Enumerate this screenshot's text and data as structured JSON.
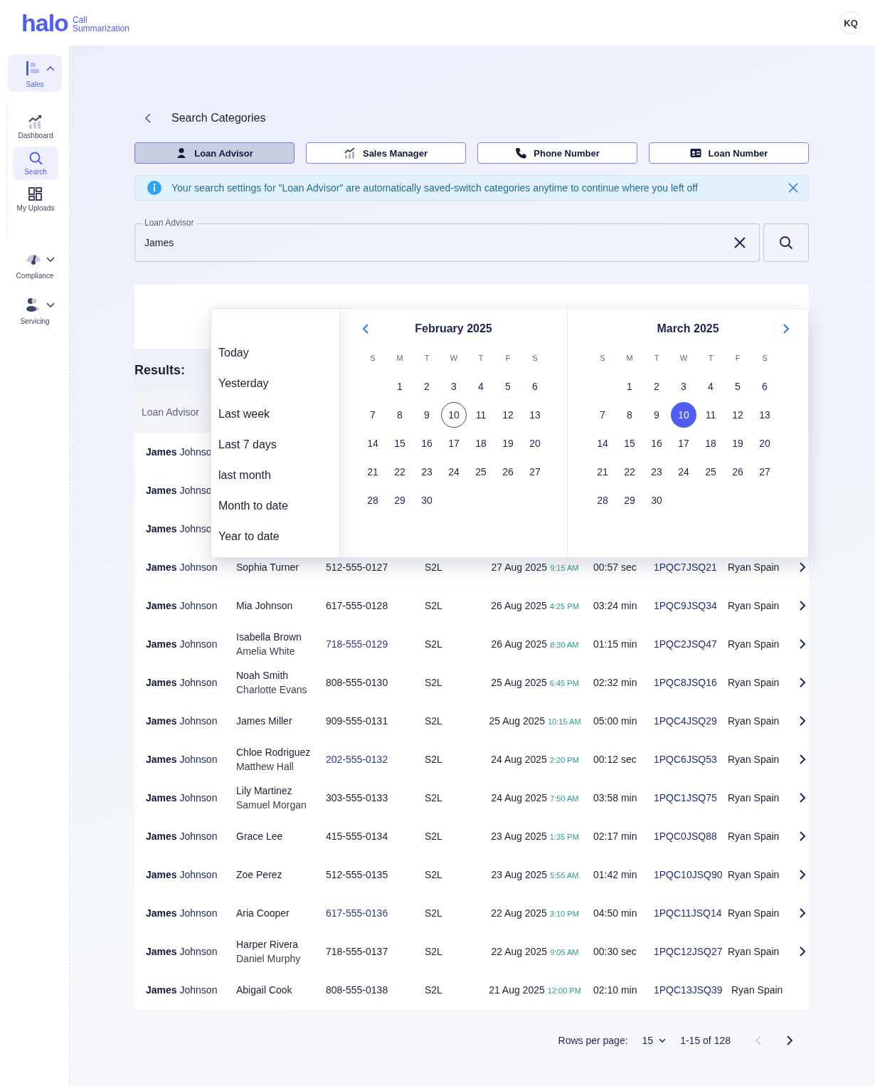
{
  "header": {
    "logo": "halo",
    "product": [
      "Call",
      "Summarization"
    ],
    "avatar": "KQ"
  },
  "sidebar": {
    "groups": [
      {
        "label": "Sales",
        "expanded": true,
        "children": [
          {
            "label": "Dashboard",
            "selected": false
          },
          {
            "label": "Search",
            "selected": true
          },
          {
            "label": "My Uploads",
            "selected": false
          }
        ]
      },
      {
        "label": "Compliance",
        "expanded": false
      },
      {
        "label": "Servicing",
        "expanded": false
      }
    ]
  },
  "page": {
    "title": "Search Categories"
  },
  "tabs": [
    {
      "label": "Loan Advisor",
      "selected": true
    },
    {
      "label": "Sales Manager",
      "selected": false
    },
    {
      "label": "Phone Number",
      "selected": false
    },
    {
      "label": "Loan Number",
      "selected": false
    }
  ],
  "banner": {
    "text": "Your search settings for \"Loan Advisor\" are automatically saved-switch categories anytime to continue where you left off"
  },
  "search": {
    "label": "Loan Advisor",
    "value": "James"
  },
  "results": {
    "title": "Results:",
    "columns": [
      "Loan Advisor"
    ],
    "rows": [
      {
        "advisor": "**James** Johnso"
      },
      {
        "advisor": "**James** Johnso"
      },
      {
        "advisor": "**James** Johnso"
      },
      {
        "advisor": "**James** Johnson",
        "customers": [
          "Sophia Turner"
        ],
        "phone": "512-555-0127",
        "phone_link": false,
        "type": "S2L",
        "date": "27 Aug 2025",
        "time": "9:15 AM",
        "duration": "00:57 sec",
        "loan": "1PQC7JSQ21",
        "manager": "Ryan Spain",
        "expandable": true
      },
      {
        "advisor": "**James** Johnson",
        "customers": [
          "Mia Johnson"
        ],
        "phone": "617-555-0128",
        "phone_link": false,
        "type": "S2L",
        "date": "26 Aug 2025",
        "time": "4:25 PM",
        "duration": "03:24 min",
        "loan": "1PQC9JSQ34",
        "manager": "Ryan Spain",
        "expandable": true
      },
      {
        "advisor": "**James** Johnson",
        "customers": [
          "Isabella Brown",
          "Amelia White"
        ],
        "phone": "718-555-0129",
        "phone_link": true,
        "type": "S2L",
        "date": "26 Aug 2025",
        "time": "8:30 AM",
        "duration": "01:15 min",
        "loan": "1PQC2JSQ47",
        "manager": "Ryan Spain",
        "expandable": true
      },
      {
        "advisor": "**James** Johnson",
        "customers": [
          "Noah Smith",
          "Charlotte Evans"
        ],
        "phone": "808-555-0130",
        "phone_link": false,
        "type": "S2L",
        "date": "25 Aug 2025",
        "time": "6:45 PM",
        "duration": "02:32 min",
        "loan": "1PQC8JSQ16",
        "manager": "Ryan Spain",
        "expandable": true
      },
      {
        "advisor": "**James** Johnson",
        "customers": [
          "James Miller"
        ],
        "phone": "909-555-0131",
        "phone_link": false,
        "type": "S2L",
        "date": "25 Aug 2025",
        "time": "10:15 AM",
        "duration": "05:00 min",
        "loan": "1PQC4JSQ29",
        "manager": "Ryan Spain",
        "expandable": true
      },
      {
        "advisor": "**James** Johnson",
        "customers": [
          "Chloe Rodriguez",
          "Matthew Hall"
        ],
        "phone": "202-555-0132",
        "phone_link": true,
        "type": "S2L",
        "date": "24 Aug 2025",
        "time": "2:20 PM",
        "duration": "00:12 sec",
        "loan": "1PQC6JSQ53",
        "manager": "Ryan Spain",
        "expandable": true
      },
      {
        "advisor": "**James** Johnson",
        "customers": [
          "Lily Martinez",
          "Samuel Morgan"
        ],
        "phone": "303-555-0133",
        "phone_link": false,
        "type": "S2L",
        "date": "24 Aug 2025",
        "time": "7:50 AM",
        "duration": "03:58 min",
        "loan": "1PQC1JSQ75",
        "manager": "Ryan Spain",
        "expandable": true
      },
      {
        "advisor": "**James** Johnson",
        "customers": [
          "Grace Lee"
        ],
        "phone": "415-555-0134",
        "phone_link": false,
        "type": "S2L",
        "date": "23 Aug 2025",
        "time": "1:35 PM",
        "duration": "02:17 min",
        "loan": "1PQC0JSQ88",
        "manager": "Ryan Spain",
        "expandable": true
      },
      {
        "advisor": "**James** Johnson",
        "customers": [
          "Zoe Perez"
        ],
        "phone": "512-555-0135",
        "phone_link": false,
        "type": "S2L",
        "date": "23 Aug 2025",
        "time": "5:55 AM",
        "duration": "01:42 min",
        "loan": "1PQC10JSQ90",
        "manager": "Ryan Spain",
        "expandable": true
      },
      {
        "advisor": "**James** Johnson",
        "customers": [
          "Aria Cooper"
        ],
        "phone": "617-555-0136",
        "phone_link": true,
        "type": "S2L",
        "date": "22 Aug 2025",
        "time": "3:10 PM",
        "duration": "04:50 min",
        "loan": "1PQC11JSQ14",
        "manager": "Ryan Spain",
        "expandable": true
      },
      {
        "advisor": "**James** Johnson",
        "customers": [
          "Harper Rivera",
          "Daniel Murphy"
        ],
        "phone": "718-555-0137",
        "phone_link": false,
        "type": "S2L",
        "date": "22 Aug 2025",
        "time": "9:05 AM",
        "duration": "00:30 sec",
        "loan": "1PQC12JSQ27",
        "manager": "Ryan Spain",
        "expandable": true
      },
      {
        "advisor": "**James** Johnson",
        "customers": [
          "Abigail Cook"
        ],
        "phone": "808-555-0138",
        "phone_link": false,
        "type": "S2L",
        "date": "21 Aug 2025",
        "time": "12:00 PM",
        "duration": "02:10 min",
        "loan": "1PQC13JSQ39",
        "manager": "Ryan Spain",
        "expandable": false
      }
    ]
  },
  "date_picker": {
    "presets": [
      "Today",
      "Yesterday",
      "Last week",
      "Last 7 days",
      "last month",
      "Month to date",
      "Year to date"
    ],
    "months": [
      {
        "name": "February 2025",
        "weekdays": [
          "S",
          "M",
          "T",
          "W",
          "T",
          "F",
          "S"
        ],
        "weeks": [
          {
            "right_aligned": true,
            "days": [
              {
                "label": "1",
                "today": false,
                "selected": false
              },
              {
                "label": "2",
                "today": false,
                "selected": false
              },
              {
                "label": "3",
                "today": false,
                "selected": false
              },
              {
                "label": "4",
                "today": false,
                "selected": false
              },
              {
                "label": "5",
                "today": false,
                "selected": false
              },
              {
                "label": "6",
                "today": false,
                "selected": false
              }
            ]
          },
          {
            "right_aligned": false,
            "days": [
              {
                "label": "7",
                "today": false,
                "selected": false
              },
              {
                "label": "8",
                "today": false,
                "selected": false
              },
              {
                "label": "9",
                "today": false,
                "selected": false
              },
              {
                "label": "10",
                "today": true,
                "selected": false
              },
              {
                "label": "11",
                "today": false,
                "selected": false
              },
              {
                "label": "12",
                "today": false,
                "selected": false
              },
              {
                "label": "13",
                "today": false,
                "selected": false
              }
            ]
          },
          {
            "right_aligned": false,
            "days": [
              {
                "label": "14",
                "today": false,
                "selected": false
              },
              {
                "label": "15",
                "today": false,
                "selected": false
              },
              {
                "label": "16",
                "today": false,
                "selected": false
              },
              {
                "label": "17",
                "today": false,
                "selected": false
              },
              {
                "label": "18",
                "today": false,
                "selected": false
              },
              {
                "label": "19",
                "today": false,
                "selected": false
              },
              {
                "label": "20",
                "today": false,
                "selected": false
              }
            ]
          },
          {
            "right_aligned": false,
            "days": [
              {
                "label": "21",
                "today": false,
                "selected": false
              },
              {
                "label": "22",
                "today": false,
                "selected": false
              },
              {
                "label": "23",
                "today": false,
                "selected": false
              },
              {
                "label": "24",
                "today": false,
                "selected": false
              },
              {
                "label": "25",
                "today": false,
                "selected": false
              },
              {
                "label": "26",
                "today": false,
                "selected": false
              },
              {
                "label": "27",
                "today": false,
                "selected": false
              }
            ]
          },
          {
            "right_aligned": false,
            "days": [
              {
                "label": "28",
                "today": false,
                "selected": false
              },
              {
                "label": "29",
                "today": false,
                "selected": false
              },
              {
                "label": "30",
                "today": false,
                "selected": false
              }
            ]
          }
        ]
      },
      {
        "name": "March 2025",
        "weekdays": [
          "S",
          "M",
          "T",
          "W",
          "T",
          "F",
          "S"
        ],
        "weeks": [
          {
            "right_aligned": true,
            "days": [
              {
                "label": "1",
                "today": false,
                "selected": false
              },
              {
                "label": "2",
                "today": false,
                "selected": false
              },
              {
                "label": "3",
                "today": false,
                "selected": false
              },
              {
                "label": "4",
                "today": false,
                "selected": false
              },
              {
                "label": "5",
                "today": false,
                "selected": false
              },
              {
                "label": "6",
                "today": false,
                "selected": false
              }
            ]
          },
          {
            "right_aligned": false,
            "days": [
              {
                "label": "7",
                "today": false,
                "selected": false
              },
              {
                "label": "8",
                "today": false,
                "selected": false
              },
              {
                "label": "9",
                "today": false,
                "selected": false
              },
              {
                "label": "10",
                "today": false,
                "selected": true
              },
              {
                "label": "11",
                "today": false,
                "selected": false
              },
              {
                "label": "12",
                "today": false,
                "selected": false
              },
              {
                "label": "13",
                "today": false,
                "selected": false
              }
            ]
          },
          {
            "right_aligned": false,
            "days": [
              {
                "label": "14",
                "today": false,
                "selected": false
              },
              {
                "label": "15",
                "today": false,
                "selected": false
              },
              {
                "label": "16",
                "today": false,
                "selected": false
              },
              {
                "label": "17",
                "today": false,
                "selected": false
              },
              {
                "label": "18",
                "today": false,
                "selected": false
              },
              {
                "label": "19",
                "today": false,
                "selected": false
              },
              {
                "label": "20",
                "today": false,
                "selected": false
              }
            ]
          },
          {
            "right_aligned": false,
            "days": [
              {
                "label": "21",
                "today": false,
                "selected": false
              },
              {
                "label": "22",
                "today": false,
                "selected": false
              },
              {
                "label": "23",
                "today": false,
                "selected": false
              },
              {
                "label": "24",
                "today": false,
                "selected": false
              },
              {
                "label": "25",
                "today": false,
                "selected": false
              },
              {
                "label": "26",
                "today": false,
                "selected": false
              },
              {
                "label": "27",
                "today": false,
                "selected": false
              }
            ]
          },
          {
            "right_aligned": false,
            "days": [
              {
                "label": "28",
                "today": false,
                "selected": false
              },
              {
                "label": "29",
                "today": false,
                "selected": false
              },
              {
                "label": "30",
                "today": false,
                "selected": false
              }
            ]
          }
        ]
      }
    ]
  },
  "pagination": {
    "rows_label": "Rows per page:",
    "rows_value": "15",
    "range": "1-15 of 128",
    "prev_disabled": true
  }
}
